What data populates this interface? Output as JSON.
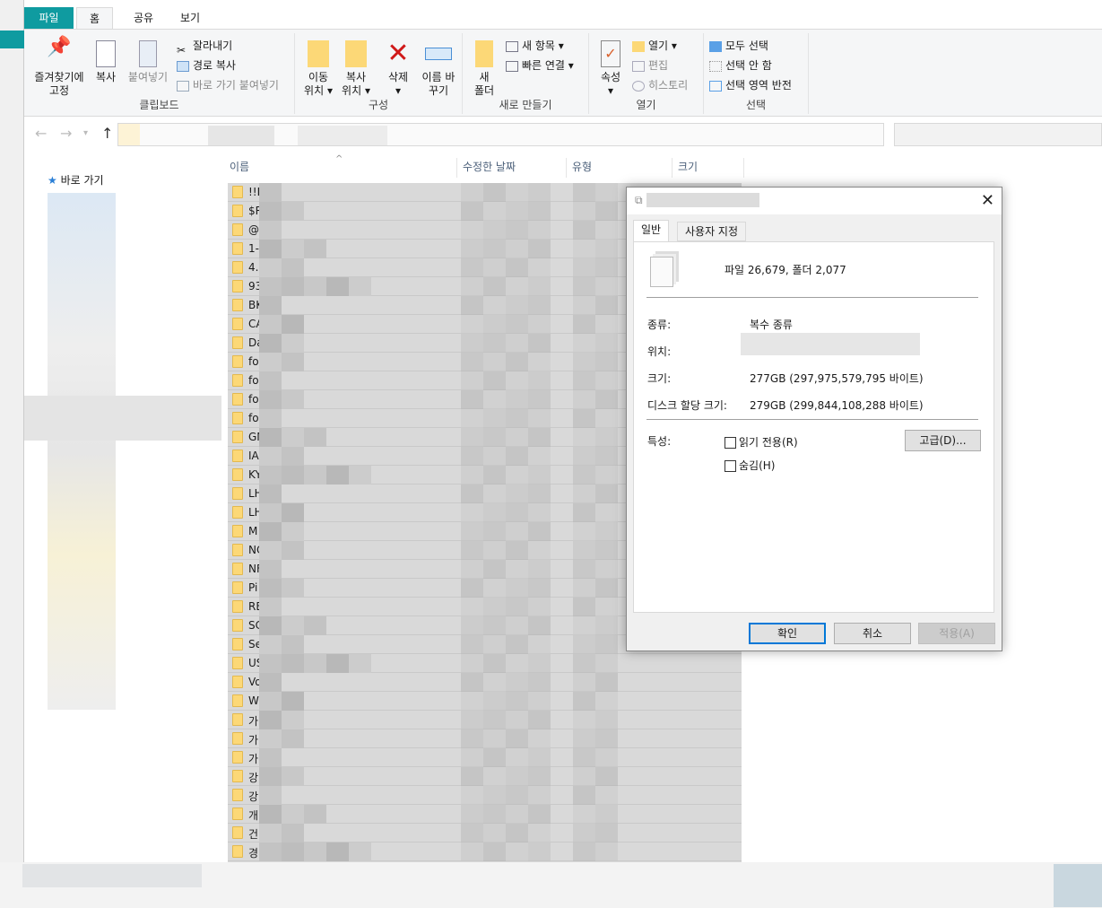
{
  "ribbon": {
    "tabs": [
      "파일",
      "홈",
      "공유",
      "보기"
    ],
    "clipboard": {
      "pin": "즐겨찾기에 고정",
      "copy": "복사",
      "paste": "붙여넣기",
      "cut": "잘라내기",
      "copy_path": "경로 복사",
      "paste_shortcut": "바로 가기 붙여넣기",
      "label": "클립보드"
    },
    "organize": {
      "move_to": "이동 위치",
      "copy_to": "복사 위치",
      "delete": "삭제",
      "rename": "이름 바꾸기",
      "label": "구성"
    },
    "new": {
      "new_folder": "새 폴더",
      "new_item": "새 항목",
      "easy_access": "빠른 연결",
      "label": "새로 만들기"
    },
    "open": {
      "properties": "속성",
      "open": "열기",
      "edit": "편집",
      "history": "히스토리",
      "label": "열기"
    },
    "select": {
      "select_all": "모두 선택",
      "select_none": "선택 안 함",
      "invert": "선택 영역 반전",
      "label": "선택"
    }
  },
  "nav": {
    "quick_access": "바로 가기"
  },
  "columns": {
    "name": "이름",
    "modified": "수정한 날짜",
    "type": "유형",
    "size": "크기"
  },
  "files": [
    "!!D",
    "$R",
    "@",
    "1-",
    "4.",
    "93",
    "BK",
    "CA",
    "Da",
    "fo",
    "fo",
    "fo",
    "fo",
    "GM",
    "IA",
    "KY",
    "LH",
    "LH",
    "M",
    "NC",
    "NF",
    "Pi",
    "RE",
    "SC",
    "Se",
    "US",
    "Vo",
    "W",
    "가",
    "가",
    "가",
    "강",
    "강",
    "개",
    "건",
    "경"
  ],
  "dialog": {
    "tabs": [
      "일반",
      "사용자 지정"
    ],
    "summary": "파일 26,679, 폴더 2,077",
    "type_label": "종류:",
    "type_value": "복수 종류",
    "location_label": "위치:",
    "size_label": "크기:",
    "size_value": "277GB (297,975,579,795 바이트)",
    "disk_label": "디스크 할당 크기:",
    "disk_value": "279GB (299,844,108,288 바이트)",
    "attr_label": "특성:",
    "readonly": "읽기 전용(R)",
    "hidden": "숨김(H)",
    "advanced": "고급(D)...",
    "ok": "확인",
    "cancel": "취소",
    "apply": "적용(A)"
  }
}
